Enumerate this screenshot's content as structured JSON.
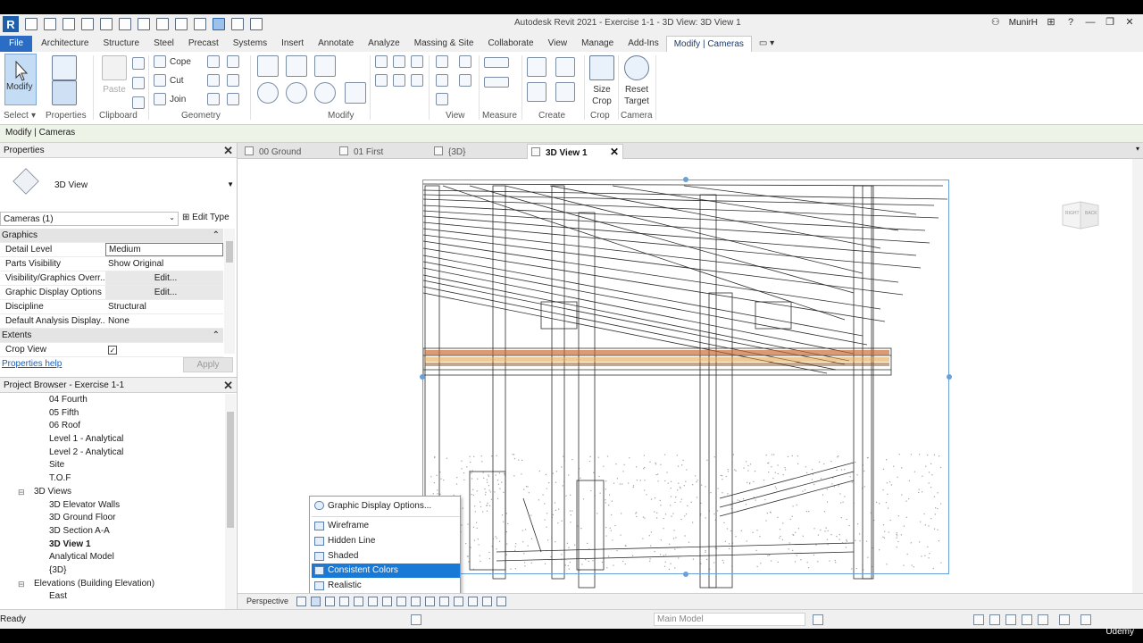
{
  "window": {
    "title": "Autodesk Revit 2021 - Exercise 1-1 - 3D View: 3D View 1",
    "user": "MunirH",
    "help": "?"
  },
  "ribbon_tabs": [
    "Architecture",
    "Structure",
    "Steel",
    "Precast",
    "Systems",
    "Insert",
    "Annotate",
    "Analyze",
    "Massing & Site",
    "Collaborate",
    "View",
    "Manage",
    "Add-Ins",
    "Modify | Cameras"
  ],
  "file_tab": "File",
  "ribbon": {
    "modify_label": "Modify",
    "properties_label": "Properties",
    "paste_label": "Paste",
    "cope_label": "Cope",
    "cut_label": "Cut",
    "join_label": "Join",
    "size_crop_label": "Size\nCrop",
    "reset_target_label": "Reset\nTarget",
    "panels": {
      "select": "Select",
      "properties": "Properties",
      "clipboard": "Clipboard",
      "geometry": "Geometry",
      "modify": "Modify",
      "view": "View",
      "measure": "Measure",
      "create": "Create",
      "crop": "Crop",
      "camera": "Camera"
    }
  },
  "context_bar": "Modify | Cameras",
  "properties": {
    "header": "Properties",
    "type_name": "3D View",
    "filter": "Cameras (1)",
    "edit_type": "Edit Type",
    "groups": {
      "graphics": "Graphics",
      "extents": "Extents"
    },
    "rows": [
      {
        "key": "Detail Level",
        "value": "Medium"
      },
      {
        "key": "Parts Visibility",
        "value": "Show Original"
      },
      {
        "key": "Visibility/Graphics Overr...",
        "value": "Edit..."
      },
      {
        "key": "Graphic Display Options",
        "value": "Edit..."
      },
      {
        "key": "Discipline",
        "value": "Structural"
      },
      {
        "key": "Default Analysis Display...",
        "value": "None"
      }
    ],
    "crop_view_key": "Crop View",
    "crop_view_checked": true,
    "help_link": "Properties help",
    "apply": "Apply"
  },
  "project_browser": {
    "header": "Project Browser - Exercise 1-1",
    "items": [
      {
        "label": "04 Fourth",
        "level": 2
      },
      {
        "label": "05 Fifth",
        "level": 2
      },
      {
        "label": "06 Roof",
        "level": 2
      },
      {
        "label": "Level 1 - Analytical",
        "level": 2
      },
      {
        "label": "Level 2 - Analytical",
        "level": 2
      },
      {
        "label": "Site",
        "level": 2
      },
      {
        "label": "T.O.F",
        "level": 2
      },
      {
        "label": "3D Views",
        "level": 1,
        "toggle": "−"
      },
      {
        "label": "3D Elevator Walls",
        "level": 2
      },
      {
        "label": "3D Ground Floor",
        "level": 2
      },
      {
        "label": "3D Section A-A",
        "level": 2
      },
      {
        "label": "3D View 1",
        "level": 2,
        "bold": true
      },
      {
        "label": "Analytical Model",
        "level": 2
      },
      {
        "label": "{3D}",
        "level": 2
      },
      {
        "label": "Elevations (Building Elevation)",
        "level": 1,
        "toggle": "−"
      },
      {
        "label": "East",
        "level": 2
      }
    ]
  },
  "view_tabs": [
    {
      "label": "00 Ground",
      "active": false
    },
    {
      "label": "01 First",
      "active": false
    },
    {
      "label": "{3D}",
      "active": false
    },
    {
      "label": "3D View 1",
      "active": true
    }
  ],
  "view_cube": {
    "left": "RIGHT",
    "right": "BACK"
  },
  "view_control_bar": {
    "projection": "Perspective"
  },
  "display_menu": {
    "options": "Graphic Display Options...",
    "styles": [
      "Wireframe",
      "Hidden Line",
      "Shaded",
      "Consistent Colors",
      "Realistic"
    ],
    "selected": "Consistent Colors"
  },
  "status": {
    "text": "Ready",
    "model": "Main Model"
  },
  "watermark": "Udemy",
  "colors": {
    "accent": "#1979d6",
    "file_tab": "#2b6cc4",
    "crop_region": "#6aa0d8"
  }
}
